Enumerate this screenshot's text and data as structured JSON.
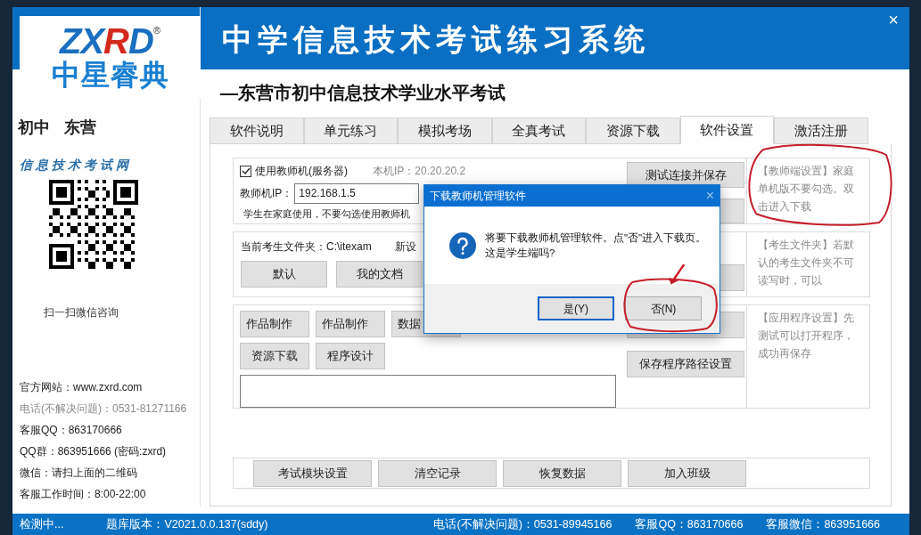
{
  "logo": {
    "letters": [
      {
        "text": "Z",
        "color": "#1a6fc0"
      },
      {
        "text": "X",
        "color": "#1a6fc0"
      },
      {
        "text": "R",
        "color": "#d42a1e"
      },
      {
        "text": "D",
        "color": "#1a6fc0"
      }
    ],
    "registered": "®",
    "chinese": "中星睿典"
  },
  "window": {
    "title": "中学信息技术考试练习系统",
    "subtitle": "—东营市初中信息技术学业水平考试",
    "close": "×"
  },
  "sidebar": {
    "level": "初中",
    "region": "东营",
    "site_name": "信息技术考试网",
    "qr_caption": "扫一扫微信咨询",
    "contacts": [
      {
        "text": "官方网站：www.zxrd.com",
        "muted": false
      },
      {
        "text": "电话(不解决问题)：0531-81271166",
        "muted": true
      },
      {
        "text": "客服QQ：863170666",
        "muted": false
      },
      {
        "text": "QQ群：863951666 (密码:zxrd)",
        "muted": false
      },
      {
        "text": "微信：请扫上面的二维码",
        "muted": false
      },
      {
        "text": "客服工作时间：8:00-22:00",
        "muted": false
      }
    ]
  },
  "tabs": [
    {
      "label": "软件说明",
      "selected": false
    },
    {
      "label": "单元练习",
      "selected": false
    },
    {
      "label": "模拟考场",
      "selected": false
    },
    {
      "label": "全真考试",
      "selected": false
    },
    {
      "label": "资源下载",
      "selected": false
    },
    {
      "label": "软件设置",
      "selected": true
    },
    {
      "label": "激活注册",
      "selected": false
    }
  ],
  "teacher_section": {
    "use_teacher": {
      "label": "使用教师机(服务器)",
      "checked": true
    },
    "local_ip": "本机IP：20.20.20.2",
    "ip_label": "教师机IP：",
    "ip_value": "192.168.1.5",
    "hint": "学生在家庭使用，不要勾选使用教师机",
    "buttons": [
      "测试连接并保存"
    ],
    "note": "【教师端设置】家庭单机版不要勾选。双击进入下载"
  },
  "folder_section": {
    "current_folder": "当前考生文件夹：C:\\itexam",
    "new_setting": "新设",
    "buttons": [
      "默认",
      "我的文档"
    ],
    "note": "【考生文件夹】若默认的考生文件夹不可读写时，可以"
  },
  "app_section": {
    "buttons_row1": [
      "作品制作",
      "作品制作",
      "数据"
    ],
    "buttons_row2": [
      "资源下载",
      "程序设计"
    ],
    "save_button": "保存程序路径设置",
    "note": "【应用程序设置】先测试可以打开程序，成功再保存"
  },
  "bottom_buttons": [
    "考试模块设置",
    "清空记录",
    "恢复数据",
    "加入班级"
  ],
  "dialog": {
    "title": "下载教师机管理软件",
    "close": "×",
    "message": "将要下载教师机管理软件。点\"否\"进入下载页。这是学生端吗?",
    "buttons": [
      {
        "label": "是(Y)",
        "selected": true
      },
      {
        "label": "否(N)",
        "selected": false
      }
    ]
  },
  "status_bar": [
    "检测中...",
    "题库版本：V2021.0.0.137(sddy)",
    "电话(不解决问题)：0531-89945166",
    "客服QQ：863170666",
    "客服微信：863951666"
  ]
}
